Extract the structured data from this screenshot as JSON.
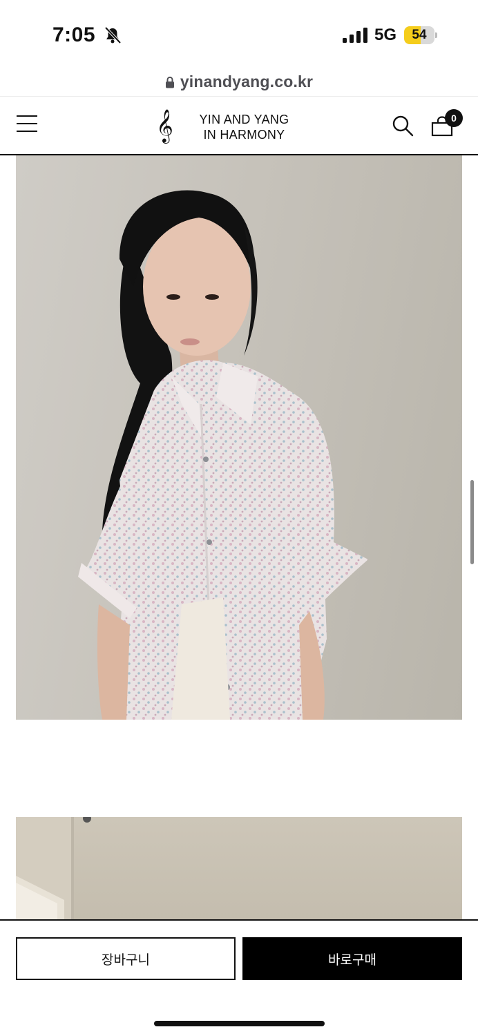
{
  "status_bar": {
    "time": "7:05",
    "network": "5G",
    "battery": "54",
    "battery_level": 0.54,
    "icons": [
      "bell-slash-icon",
      "signal-icon",
      "battery-icon"
    ]
  },
  "browser": {
    "url": "yinandyang.co.kr",
    "icon": "lock-icon"
  },
  "header": {
    "logo_line1": "YIN AND YANG",
    "logo_line2": "IN HARMONY",
    "cart_count": "0",
    "icons": [
      "menu-icon",
      "treble-clef-icon",
      "search-icon",
      "shopping-bag-icon"
    ]
  },
  "photos": [
    {
      "subject": "model in floral short-sleeve shirt"
    },
    {
      "subject": "room interior"
    }
  ],
  "actions": {
    "cart_label": "장바구니",
    "buy_label": "바로구매"
  },
  "colors": {
    "primary": "#000000",
    "battery_accent": "#f5cd1b",
    "background": "#ffffff"
  }
}
